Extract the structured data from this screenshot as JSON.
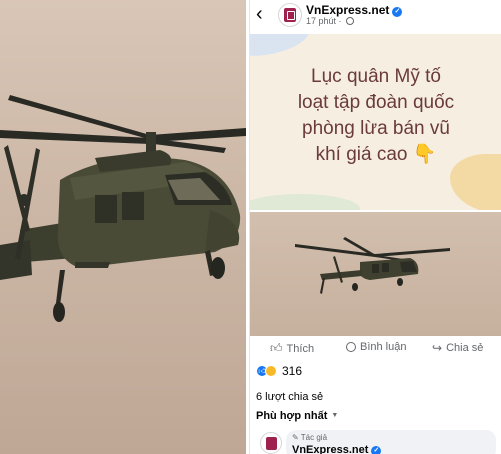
{
  "header": {
    "back_icon": "chevron-left-icon",
    "page_name": "VnExpress.net",
    "time": "17 phút ·"
  },
  "text_post": {
    "line1": "Lục quân Mỹ tố",
    "line2": "loạt tập đoàn quốc",
    "line3": "phòng lừa bán vũ",
    "line4": "khí giá cao 👇"
  },
  "actions": {
    "like": "Thích",
    "comment": "Bình luận",
    "share": "Chia sẻ"
  },
  "reactions": {
    "count": "316"
  },
  "shares_text": "6 lượt chia sẻ",
  "sort_label": "Phù hợp nhất",
  "comment": {
    "author_tag": "✎ Tác giả",
    "name": "VnExpress.net"
  },
  "colors": {
    "brand": "#9f224e",
    "facebook_blue": "#1877f2",
    "card_bg": "#f6eee0",
    "card_text": "#6a3b3a"
  }
}
